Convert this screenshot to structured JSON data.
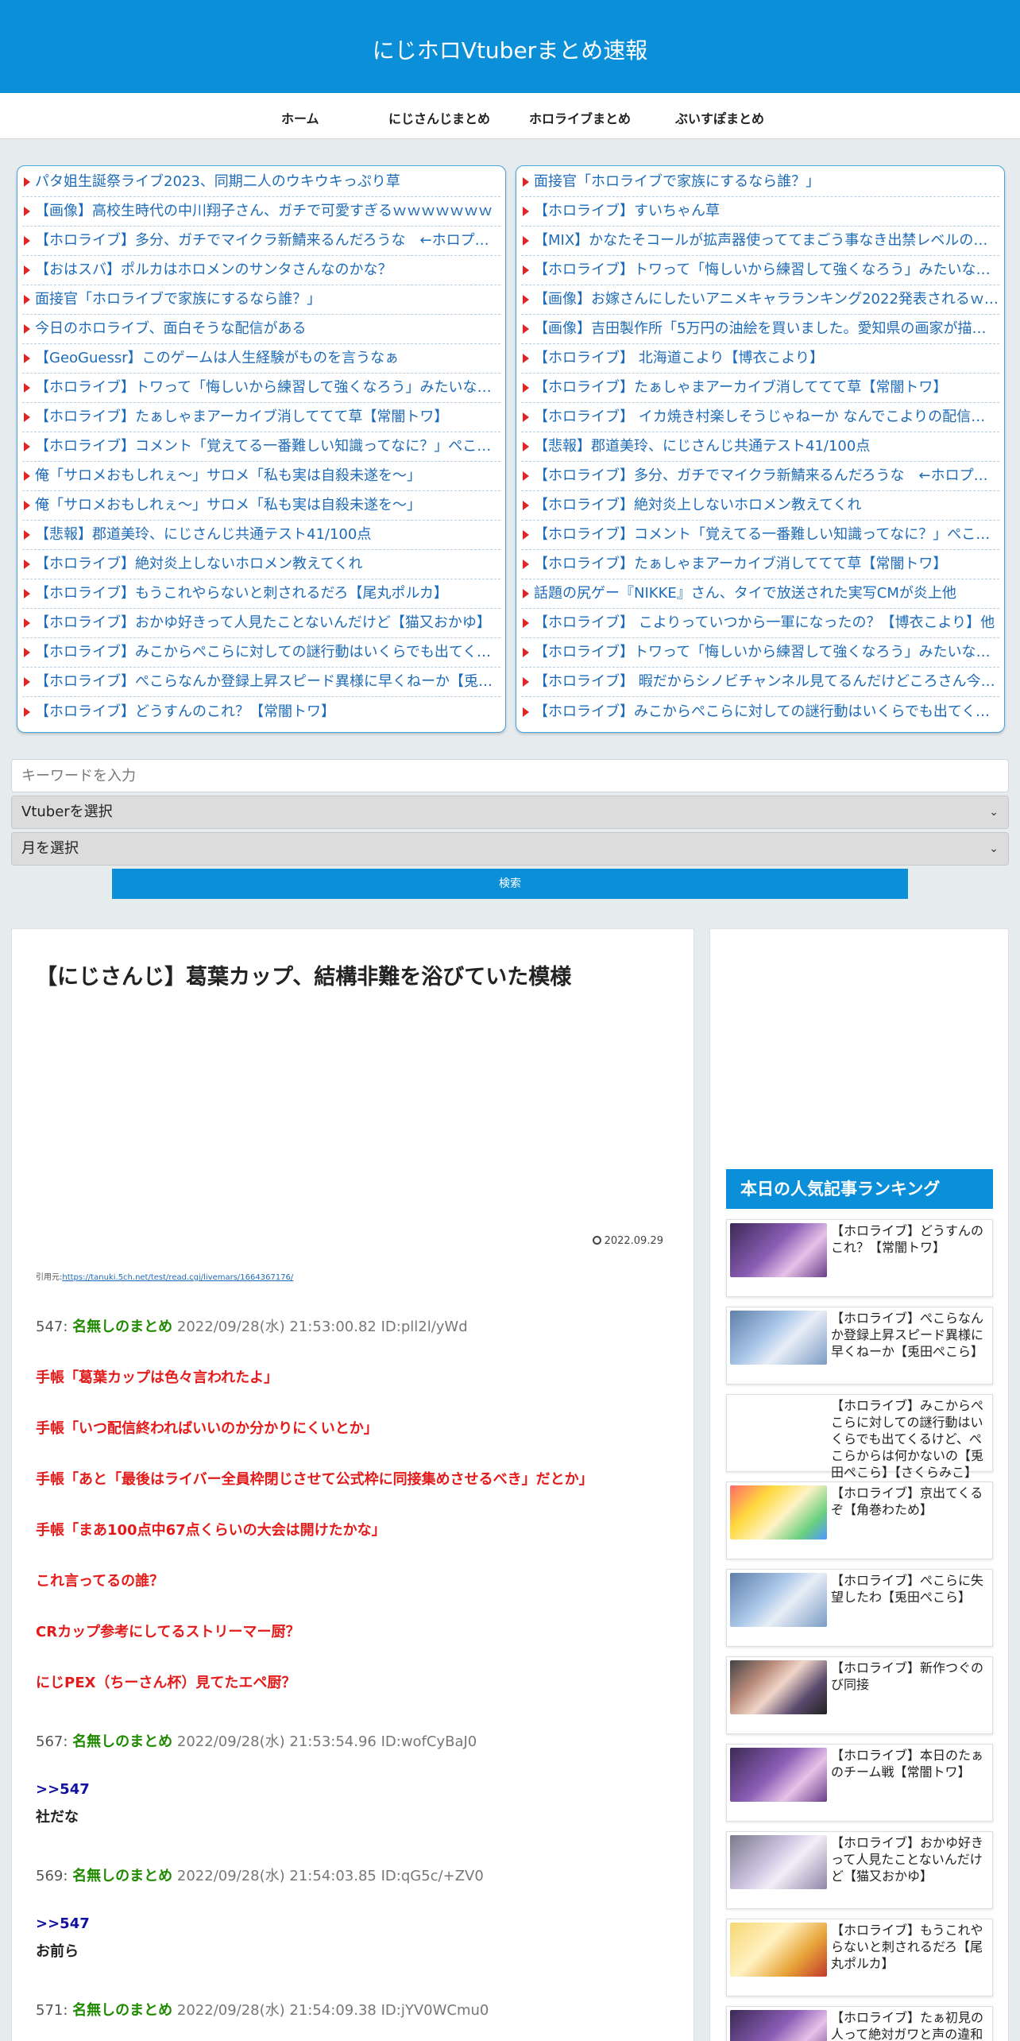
{
  "site": {
    "title": "にじホロVtuberまとめ速報"
  },
  "nav": [
    "ホーム",
    "にじさんじまとめ",
    "ホロライブまとめ",
    "ぶいすぽまとめ"
  ],
  "links_left": [
    "パタ姐生誕祭ライブ2023、同期二人のウキウキっぷり草",
    "【画像】高校生時代の中川翔子さん、ガチで可愛すぎるｗｗｗｗｗｗｗ",
    "【ホロライブ】多分、ガチでマイクラ新鯖来るんだろうな　←ホロプロ…",
    "【おはスバ】ポルカはホロメンのサンタさんなのかな？",
    "面接官「ホロライブで家族にするなら誰？」",
    "今日のホロライブ、面白そうな配信がある",
    "【GeoGuessr】このゲームは人生経験がものを言うなぁ",
    "【ホロライブ】トワって「悔しいから練習して強くなろう」みたいな感…",
    "【ホロライブ】たぁしゃまアーカイブ消しててて草【常闇トワ】",
    "【ホロライブ】コメント「覚えてる一番難しい知識ってなに？」ぺこら…",
    "俺「サロメおもしれぇ～」サロメ「私も実は自殺未遂を～」",
    "俺「サロメおもしれぇ～」サロメ「私も実は自殺未遂を～」",
    "【悲報】郡道美玲、にじさんじ共通テスト41/100点",
    "【ホロライブ】絶対炎上しないホロメン教えてくれ",
    "【ホロライブ】もうこれやらないと刺されるだろ【尾丸ポルカ】",
    "【ホロライブ】おかゆ好きって人見たことないんだけど【猫又おかゆ】",
    "【ホロライブ】みこからぺこらに対しての謎行動はいくらでも出てくる…",
    "【ホロライブ】ぺこらなんか登録上昇スピード異様に早くねーか【兎田…",
    "【ホロライブ】どうすんのこれ？【常闇トワ】"
  ],
  "links_right": [
    "面接官「ホロライブで家族にするなら誰？」",
    "【ホロライブ】すいちゃん草",
    "【MIX】かなたそコールが拡声器使っててまごう事なき出禁レベルのう…",
    "【ホロライブ】トワって「悔しいから練習して強くなろう」みたいな感…",
    "【画像】お嫁さんにしたいアニメキャラランキング2022発表されるｗ…",
    "【画像】吉田製作所「5万円の油絵を買いました。愛知県の画家が描い…",
    "【ホロライブ】 北海道こより【博衣こより】",
    "【ホロライブ】たぁしゃまアーカイブ消しててて草【常闇トワ】",
    "【ホロライブ】 イカ焼き村楽しそうじゃねーか なんでこよりの配信見…",
    "【悲報】郡道美玲、にじさんじ共通テスト41/100点",
    "【ホロライブ】多分、ガチでマイクラ新鯖来るんだろうな　←ホロプロ…",
    "【ホロライブ】絶対炎上しないホロメン教えてくれ",
    "【ホロライブ】コメント「覚えてる一番難しい知識ってなに？」ぺこら…",
    "【ホロライブ】たぁしゃまアーカイブ消しててて草【常闇トワ】",
    "話題の尻ゲー『NIKKE』さん、タイで放送された実写CMが炎上他",
    "【ホロライブ】 こよりっていつから一軍になったの？【博衣こより】他",
    "【ホロライブ】トワって「悔しいから練習して強くなろう」みたいな感…",
    "【ホロライブ】 暇だからシノビチャンネル見てるんだけどころさん今…",
    "【ホロライブ】みこからぺこらに対しての謎行動はいくらでも出てくる…"
  ],
  "search": {
    "placeholder": "キーワードを入力",
    "vtuber_select": "Vtuberを選択",
    "month_select": "月を選択",
    "button": "検索"
  },
  "article": {
    "title": "【にじさんじ】葛葉カップ、結構非難を浴びていた模様",
    "date": "2022.09.29",
    "source_label": "引用元:",
    "source_url": "https://tanuki.5ch.net/test/read.cgi/livemars/1664367176/"
  },
  "posts": [
    {
      "num": "547:",
      "name": "名無しのまとめ",
      "meta": "2022/09/28(水) 21:53:00.82 ID:pll2l/yWd"
    },
    {
      "num": "567:",
      "name": "名無しのまとめ",
      "meta": "2022/09/28(水) 21:53:54.96 ID:wofCyBaJ0"
    },
    {
      "num": "569:",
      "name": "名無しのまとめ",
      "meta": "2022/09/28(水) 21:54:03.85 ID:qG5c/+ZV0"
    },
    {
      "num": "571:",
      "name": "名無しのまとめ",
      "meta": "2022/09/28(水) 21:54:09.38 ID:jYV0WCmu0"
    }
  ],
  "post_547_lines": [
    "手帳「葛葉カップは色々言われたよ」",
    "手帳「いつ配信終わればいいのか分かりにくいとか」",
    "手帳「あと「最後はライバー全員枠閉じさせて公式枠に同接集めさせるべき」だとか」",
    "手帳「まあ100点中67点くらいの大会は開けたかな」",
    "これ言ってるの誰？",
    "CRカップ参考にしてるストリーマー厨？",
    "にじPEX（ちーさん杯）見てたエペ厨？"
  ],
  "replies": [
    {
      "anchor": ">>547",
      "body": "社だな"
    },
    {
      "anchor": ">>547",
      "body": "お前ら"
    }
  ],
  "ranking": {
    "header": "本日の人気記事ランキング",
    "items": [
      {
        "title": "【ホロライブ】どうすんのこれ？【常闇トワ】",
        "thumb": "purple"
      },
      {
        "title": "【ホロライブ】ぺこらなんか登録上昇スピード異様に早くねーか【兎田ぺこら】",
        "thumb": "blue"
      },
      {
        "title": "【ホロライブ】みこからぺこらに対しての謎行動はいくらでも出てくるけど、ぺこらからは何かないの【兎田ぺこら】【さくらみこ】",
        "thumb": "none"
      },
      {
        "title": "【ホロライブ】京出てくるぞ【角巻わため】",
        "thumb": "yellow"
      },
      {
        "title": "【ホロライブ】ぺこらに失望したわ【兎田ぺこら】",
        "thumb": "blue"
      },
      {
        "title": "【ホロライブ】新作つぐのび同接",
        "thumb": "group"
      },
      {
        "title": "【ホロライブ】本日のたぁのチーム戦【常闇トワ】",
        "thumb": "purple"
      },
      {
        "title": "【ホロライブ】おかゆ好きって人見たことないんだけど【猫又おかゆ】",
        "thumb": "lavender"
      },
      {
        "title": "【ホロライブ】もうこれやらないと刺されるだろ【尾丸ポルカ】",
        "thumb": "gold"
      },
      {
        "title": "【ホロライブ】たぁ初見の人って絶対ガワと声の違和",
        "thumb": "purple"
      }
    ]
  },
  "colors": {
    "brand": "#0a8fd8",
    "name_green": "#1f8a00",
    "quote_red": "#e31b1b",
    "anchor_blue": "#1010a0"
  }
}
